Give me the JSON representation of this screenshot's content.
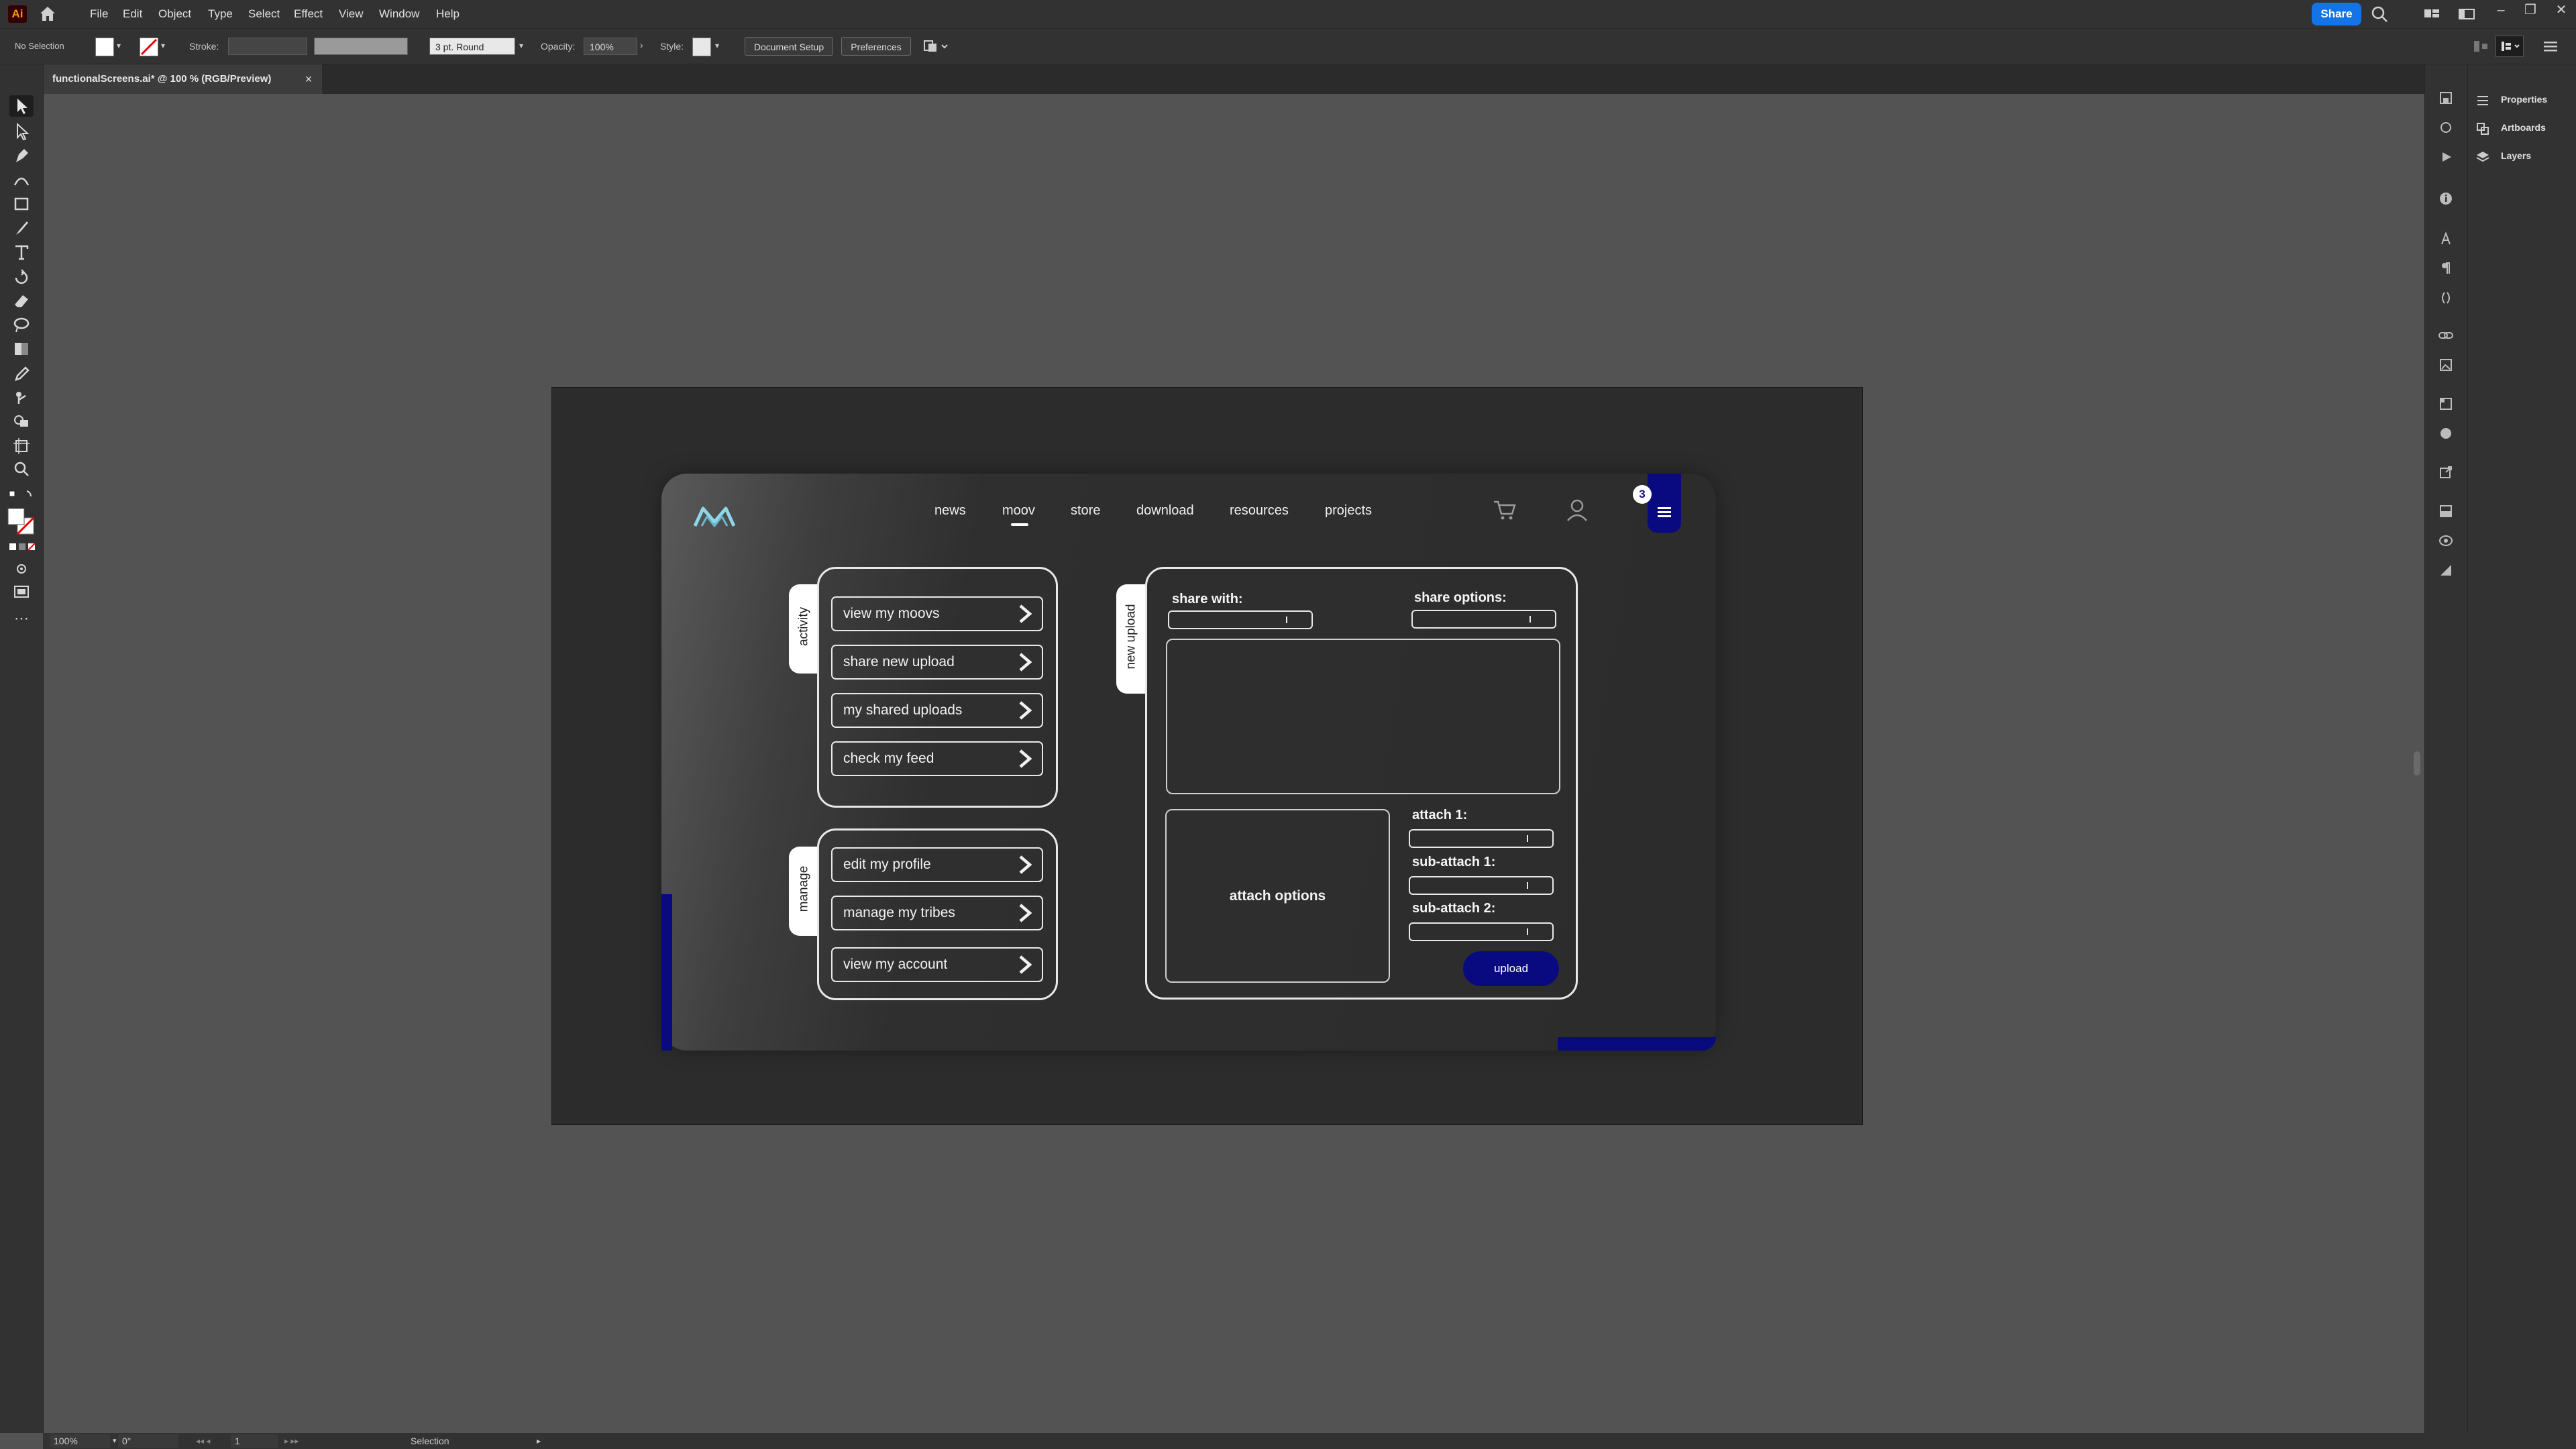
{
  "app": {
    "logo": "Ai",
    "menu": [
      "File",
      "Edit",
      "Object",
      "Type",
      "Select",
      "Effect",
      "View",
      "Window",
      "Help"
    ],
    "share_label": "Share"
  },
  "control_bar": {
    "selection": "No Selection",
    "stroke_label": "Stroke:",
    "brush": "3 pt. Round",
    "opacity_label": "Opacity:",
    "opacity_value": "100%",
    "style_label": "Style:",
    "document_setup": "Document Setup",
    "preferences": "Preferences"
  },
  "document_tab": {
    "title": "functionalScreens.ai* @ 100 % (RGB/Preview)",
    "close": "×"
  },
  "right_panel": {
    "items": [
      "Properties",
      "Artboards",
      "Layers"
    ]
  },
  "status_bar": {
    "zoom": "100%",
    "rotation": "0°",
    "artboard_number": "1",
    "tool": "Selection"
  },
  "design": {
    "nav": [
      "news",
      "moov",
      "store",
      "download",
      "resources",
      "projects"
    ],
    "active_nav": "moov",
    "menu_badge": "3",
    "activity": {
      "tab_label": "activity",
      "buttons": [
        "view my moovs",
        "share new upload",
        "my shared uploads",
        "check my feed"
      ]
    },
    "manage": {
      "tab_label": "manage",
      "buttons": [
        "edit my profile",
        "manage my tribes",
        "view my account"
      ]
    },
    "new_upload": {
      "tab_label": "new upload",
      "share_with_label": "share with:",
      "share_options_label": "share options:",
      "attach_options_label": "attach options",
      "attach1_label": "attach 1:",
      "subattach1_label": "sub-attach 1:",
      "subattach2_label": "sub-attach 2:",
      "upload_label": "upload"
    },
    "colors": {
      "accent": "#0a0a80",
      "logo": "#8fd6e8"
    }
  }
}
